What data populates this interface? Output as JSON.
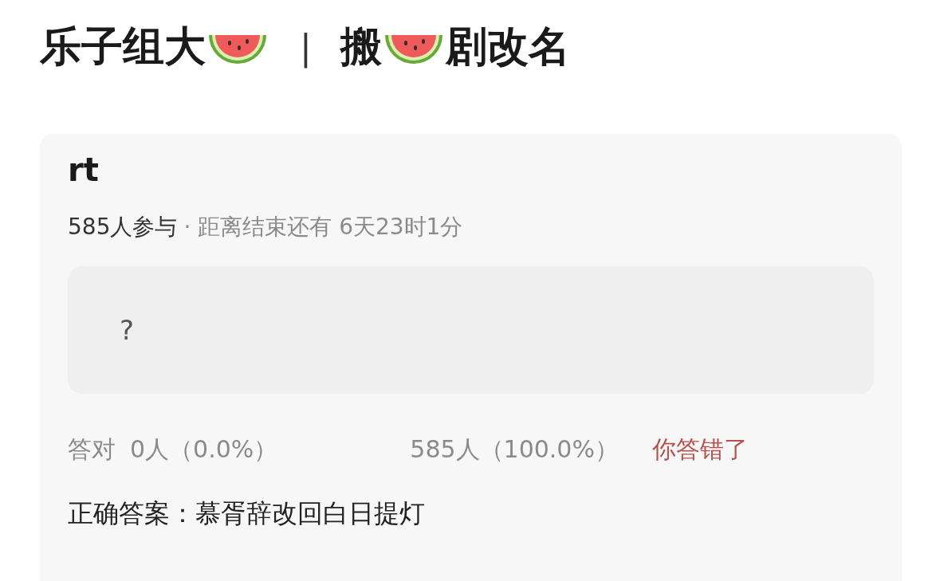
{
  "title_parts": [
    {
      "kind": "text",
      "text": "乐子组大"
    },
    {
      "kind": "icon"
    },
    {
      "kind": "divider",
      "text": "|"
    },
    {
      "kind": "text",
      "text": "搬"
    },
    {
      "kind": "icon"
    },
    {
      "kind": "text",
      "text": "剧改名"
    }
  ],
  "poll": {
    "title": "rt",
    "participants": "585人参与",
    "countdown": "· 距离结束还有 6天23时1分",
    "option": "?",
    "correct_label": "答对",
    "correct_count": "0人（0.0%）",
    "wrong_count": "585人（100.0%）",
    "verdict": "你答错了",
    "answer": "正确答案：慕胥辞改回白日提灯"
  }
}
